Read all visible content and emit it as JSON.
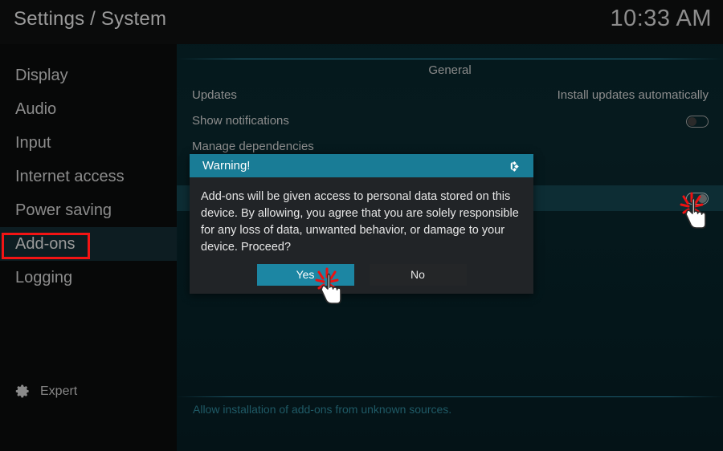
{
  "window": {
    "title": "Settings / System",
    "clock": "10:33 AM"
  },
  "sidebar": {
    "items": [
      {
        "label": "Display",
        "selected": false
      },
      {
        "label": "Audio",
        "selected": false
      },
      {
        "label": "Input",
        "selected": false
      },
      {
        "label": "Internet access",
        "selected": false
      },
      {
        "label": "Power saving",
        "selected": false
      },
      {
        "label": "Add-ons",
        "selected": true
      },
      {
        "label": "Logging",
        "selected": false
      }
    ],
    "level_button": {
      "label": "Expert",
      "icon": "gear-icon"
    }
  },
  "main": {
    "section_title": "General",
    "rows": [
      {
        "label": "Updates",
        "value": "Install updates automatically",
        "control": "text"
      },
      {
        "label": "Show notifications",
        "value": "",
        "control": "toggle-off"
      },
      {
        "label": "Manage dependencies",
        "value": "",
        "control": "none"
      }
    ],
    "hidden_row": {
      "label": "",
      "control": "toggle-on",
      "highlighted": true
    },
    "bottom_description": "Allow installation of add-ons from unknown sources."
  },
  "dialog": {
    "title": "Warning!",
    "logo": "kodi-logo",
    "message": "Add-ons will be given access to personal data stored on this device. By allowing, you agree that you are solely responsible for any loss of data, unwanted behavior, or damage to your device. Proceed?",
    "buttons": [
      {
        "label": "Yes",
        "focused": true
      },
      {
        "label": "No",
        "focused": false
      }
    ]
  },
  "annotations": {
    "highlight_box": {
      "target": "Add-ons"
    },
    "click_markers": [
      {
        "target": "Yes"
      },
      {
        "target": "unknown-sources-toggle"
      }
    ]
  },
  "colors": {
    "accent_teal": "#197c96",
    "annotation_red": "#f21414",
    "panel_bg": "#04181c",
    "dialog_bg": "#212427"
  }
}
